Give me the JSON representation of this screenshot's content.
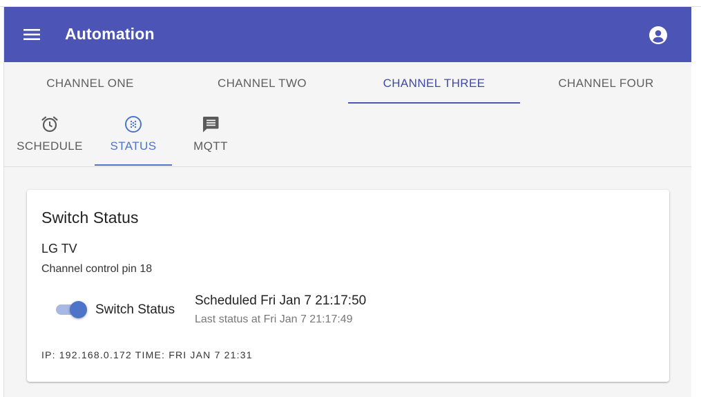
{
  "app": {
    "title": "Automation",
    "accent_color": "#4c54b5",
    "active_color": "#4d74c9"
  },
  "icons": {
    "menu": "menu-icon",
    "account": "account-circle-icon",
    "schedule": "alarm-clock-icon",
    "status": "dialpad-circle-icon",
    "mqtt": "message-icon"
  },
  "channel_tabs": [
    {
      "label": "CHANNEL ONE",
      "active": false
    },
    {
      "label": "CHANNEL TWO",
      "active": false
    },
    {
      "label": "CHANNEL THREE",
      "active": true
    },
    {
      "label": "CHANNEL FOUR",
      "active": false
    }
  ],
  "sub_tabs": [
    {
      "label": "SCHEDULE",
      "active": false
    },
    {
      "label": "STATUS",
      "active": true
    },
    {
      "label": "MQTT",
      "active": false
    }
  ],
  "card": {
    "title": "Switch Status",
    "device_name": "LG TV",
    "pin_text": "Channel control pin 18",
    "switch_label": "Switch Status",
    "switch_on": true,
    "scheduled_text": "Scheduled Fri Jan 7 21:17:50",
    "last_status_text": "Last status at Fri Jan 7 21:17:49",
    "footer_text": "IP: 192.168.0.172 TIME: FRI JAN 7 21:31"
  }
}
